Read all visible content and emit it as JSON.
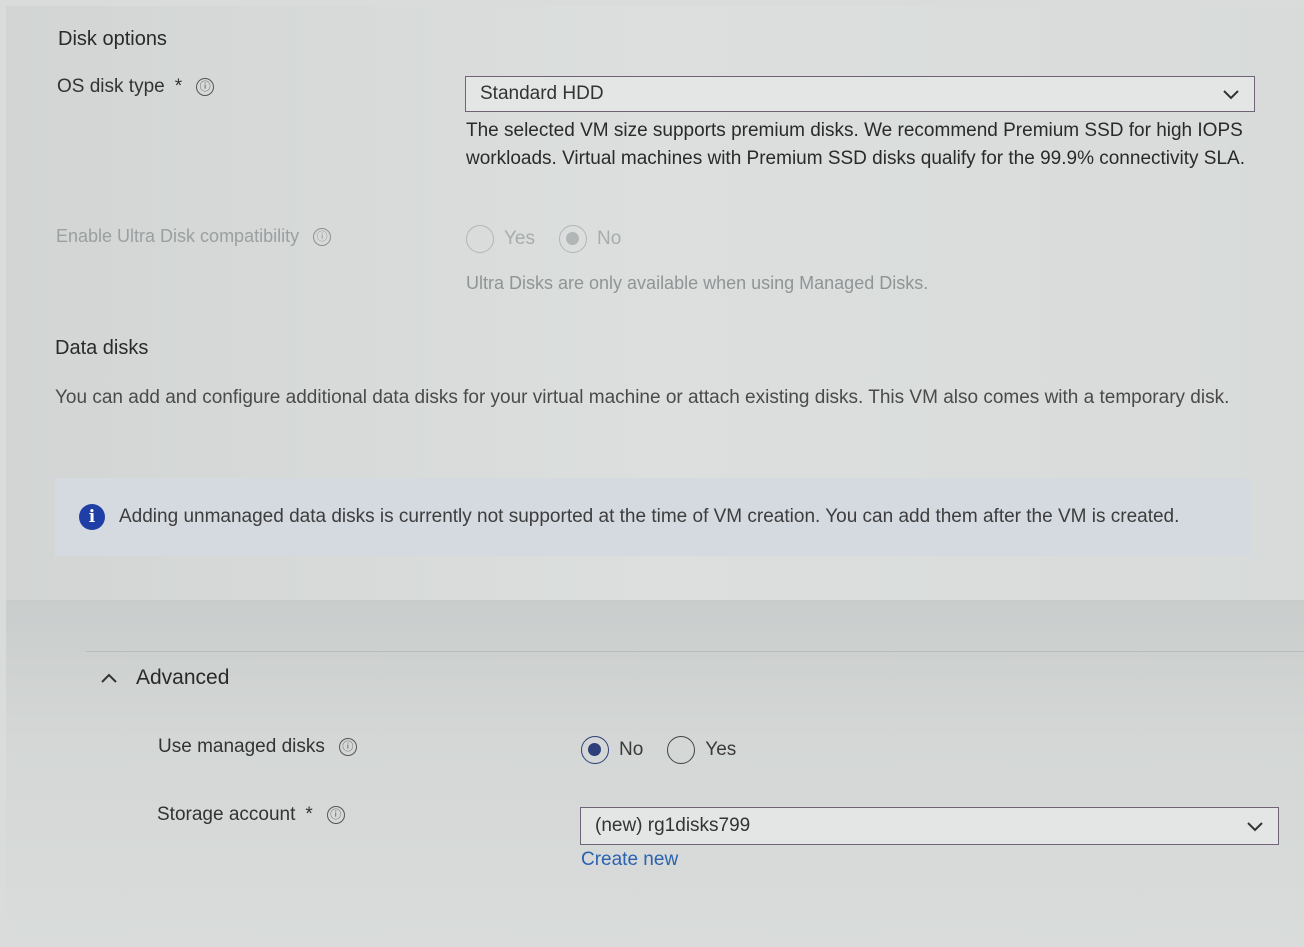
{
  "disk_options": {
    "title": "Disk options",
    "os_disk_type": {
      "label": "OS disk type",
      "required_mark": "*",
      "value": "Standard HDD",
      "help": "The selected VM size supports premium disks. We recommend Premium SSD for high IOPS workloads. Virtual machines with Premium SSD disks qualify for the 99.9% connectivity SLA."
    },
    "ultra_disk": {
      "label": "Enable Ultra Disk compatibility",
      "options": [
        "Yes",
        "No"
      ],
      "selected": "No",
      "note": "Ultra Disks are only available when using Managed Disks."
    }
  },
  "data_disks": {
    "title": "Data disks",
    "description": "You can add and configure additional data disks for your virtual machine or attach existing disks. This VM also comes with a temporary disk.",
    "banner": "Adding unmanaged data disks is currently not supported at the time of VM creation. You can add them after the VM is created."
  },
  "advanced": {
    "title": "Advanced",
    "managed_disks": {
      "label": "Use managed disks",
      "options": [
        "No",
        "Yes"
      ],
      "selected": "No"
    },
    "storage_account": {
      "label": "Storage account",
      "required_mark": "*",
      "value": "(new) rg1disks799",
      "create_link": "Create new"
    }
  },
  "icons": {
    "info": "ⓘ",
    "banner_info": "i"
  },
  "colors": {
    "accent": "#2f3f7a",
    "link": "#2a62b0",
    "banner_icon": "#1f3fa6"
  }
}
